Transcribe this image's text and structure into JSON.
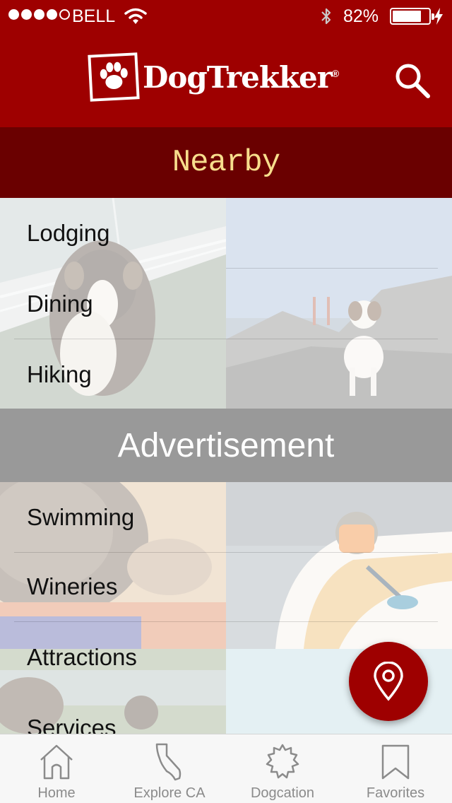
{
  "status": {
    "carrier": "BELL",
    "battery": "82%",
    "battery_level": 0.82
  },
  "header": {
    "logo_text": "DogTrekker",
    "logo_mark": "®"
  },
  "section": {
    "title": "Nearby"
  },
  "menu": [
    {
      "label": "Lodging"
    },
    {
      "label": "Dining"
    },
    {
      "label": "Hiking"
    },
    {
      "label": "Swimming"
    },
    {
      "label": "Wineries"
    },
    {
      "label": "Attractions"
    },
    {
      "label": "Services"
    }
  ],
  "ad": {
    "label": "Advertisement"
  },
  "tabs": [
    {
      "label": "Home",
      "icon": "home-icon"
    },
    {
      "label": "Explore CA",
      "icon": "california-icon"
    },
    {
      "label": "Dogcation",
      "icon": "badge-icon"
    },
    {
      "label": "Favorites",
      "icon": "bookmark-icon"
    }
  ],
  "colors": {
    "brand": "#9e0000",
    "banner": "#6a0000",
    "banner_text": "#f7dd8c",
    "ad_bg": "#999999"
  }
}
